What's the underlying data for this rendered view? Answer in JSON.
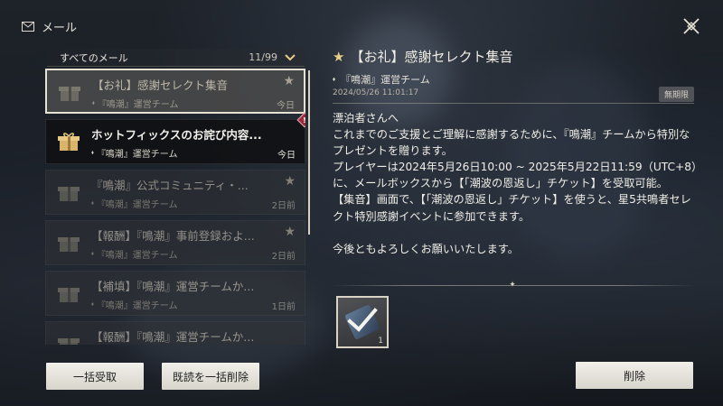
{
  "header": {
    "title": "メール",
    "mail_icon": "mail-icon",
    "close_icon": "close-icon"
  },
  "list": {
    "filter_label": "すべてのメール",
    "count": "11/99",
    "items": [
      {
        "title": "【お礼】感謝セレクト集音",
        "sender": "『鳴潮』運営チーム",
        "date": "今日",
        "state": "selected",
        "starred": true
      },
      {
        "title": "ホットフィックスのお詫び内容...",
        "sender": "『鳴潮』運営チーム",
        "date": "今日",
        "state": "unread",
        "alert": "!"
      },
      {
        "title": "『鳴潮』公式コミュニティ・...",
        "sender": "『鳴潮』運営チーム",
        "date": "2日前",
        "state": "read",
        "starred": true
      },
      {
        "title": "【報酬】『鳴潮』事前登録およ...",
        "sender": "『鳴潮』運営チーム",
        "date": "2日前",
        "state": "read",
        "starred": true
      },
      {
        "title": "【補填】『鳴潮』運営チームか...",
        "sender": "『鳴潮』運営チーム",
        "date": "1日前",
        "state": "read"
      },
      {
        "title": "【報酬】『鳴潮』運営チームか...",
        "sender": "",
        "date": "",
        "state": "read"
      }
    ]
  },
  "buttons": {
    "collect_all": "一括受取",
    "delete_read": "既読を一括削除",
    "delete": "削除"
  },
  "detail": {
    "title": "【お礼】感謝セレクト集音",
    "sender": "『鳴潮』運営チーム",
    "date": "2024/05/26 11:01:17",
    "expiry": "無期限",
    "body": "漂泊者さんへ\nこれまでのご支援とご理解に感謝するために、『鳴潮』チームから特別なプレゼントを贈ります。\nプレイヤーは2024年5月26日10:00 ~ 2025年5月22日11:59（UTC+8）に、メールボックスから【「潮波の恩返し」チケット】を受取可能。\n【集音】画面で、【「潮波の恩返し」チケット】を使うと、星5共鳴者セレクト特別感謝イベントに参加できます。\n\n今後ともよろしくお願いいたします。",
    "attachment": {
      "count": "1",
      "icon": "ticket-icon",
      "claimed": true
    }
  },
  "colors": {
    "accent_gold": "#e8cf8a",
    "alert_red": "#9c2a3c",
    "button_bg": "#f1efe9"
  }
}
